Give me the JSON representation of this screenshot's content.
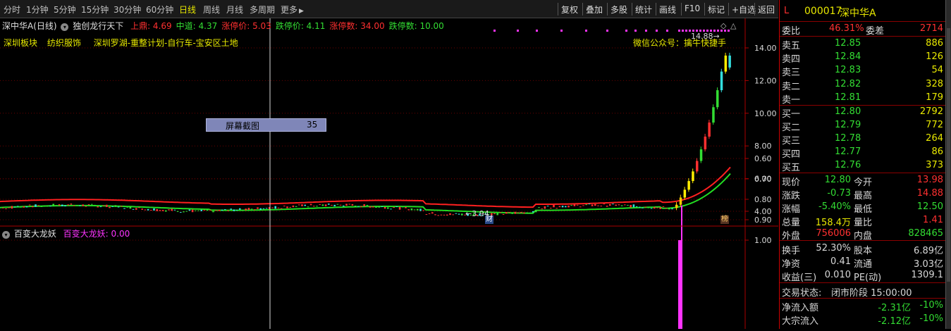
{
  "toolbar": {
    "periods": [
      "分时",
      "1分钟",
      "5分钟",
      "15分钟",
      "30分钟",
      "60分钟",
      "日线",
      "周线",
      "月线",
      "多周期",
      "更多"
    ],
    "active_period": "日线",
    "buttons": [
      "复权",
      "叠加",
      "多股",
      "统计",
      "画线",
      "F10",
      "标记",
      "+自选",
      "返回"
    ]
  },
  "main_chart": {
    "title": "深中华A(日线)",
    "indicator_name": "独创龙行天下",
    "indicators": [
      {
        "label": "上鼎: 4.69",
        "color": "#ff3030"
      },
      {
        "label": "中道: 4.37",
        "color": "#33dd33"
      },
      {
        "label": "涨停价: 5.03",
        "color": "#ff3030"
      },
      {
        "label": "跌停价: 4.11",
        "color": "#33dd33"
      },
      {
        "label": "涨停数: 34.00",
        "color": "#ff3030"
      },
      {
        "label": "跌停数: 10.00",
        "color": "#33dd33"
      }
    ],
    "tags": [
      "深圳板块",
      "纺织服饰",
      "深圳罗湖-重整计划-自行车-宝安区土地"
    ],
    "wechat": "微信公众号：擒牛快捷手",
    "screenshot_label": "屏幕截图",
    "screenshot_value": "35",
    "high_label": "14.88",
    "low_label": "3.94",
    "marker_cai": "财",
    "marker_bang": "榜",
    "price_axis": [
      "14.00",
      "12.00",
      "10.00",
      "8.00",
      "6.00",
      "4.00"
    ]
  },
  "sub_chart": {
    "title": "百变大龙妖",
    "value_label": "百变大龙妖: 0.00",
    "axis": [
      "1.00",
      "0.90",
      "0.80",
      "0.70",
      "0.60"
    ]
  },
  "chart_data": {
    "type": "candlestick",
    "title": "深中华A(日线)",
    "ylim": [
      3.6,
      15.2
    ],
    "base_period_level": 4.2,
    "recent_closes": [
      4.4,
      4.84,
      5.32,
      5.85,
      6.44,
      7.08,
      7.79,
      8.57,
      9.43,
      10.37,
      11.41,
      12.55,
      13.53,
      12.8
    ],
    "upper_band_end": 6.7,
    "lower_band_end": 6.3,
    "sub_indicator_peak": 1.0
  },
  "quote": {
    "code_prefix": "L",
    "code": "000017",
    "name": "深中华A",
    "weibi_label": "委比",
    "weibi_value": "46.31%",
    "weicha_label": "委差",
    "weicha_value": "2714",
    "sells": [
      {
        "label": "卖五",
        "price": "12.85",
        "vol": "886"
      },
      {
        "label": "卖四",
        "price": "12.84",
        "vol": "126"
      },
      {
        "label": "卖三",
        "price": "12.83",
        "vol": "54"
      },
      {
        "label": "卖二",
        "price": "12.82",
        "vol": "328"
      },
      {
        "label": "卖一",
        "price": "12.81",
        "vol": "179"
      }
    ],
    "buys": [
      {
        "label": "买一",
        "price": "12.80",
        "vol": "2792"
      },
      {
        "label": "买二",
        "price": "12.79",
        "vol": "772"
      },
      {
        "label": "买三",
        "price": "12.78",
        "vol": "264"
      },
      {
        "label": "买四",
        "price": "12.77",
        "vol": "86"
      },
      {
        "label": "买五",
        "price": "12.76",
        "vol": "373"
      }
    ],
    "stats1": [
      {
        "l1": "现价",
        "v1": "12.80",
        "c1": "#33dd33",
        "l2": "今开",
        "v2": "13.98",
        "c2": "#ff3030"
      },
      {
        "l1": "涨跌",
        "v1": "-0.73",
        "c1": "#33dd33",
        "l2": "最高",
        "v2": "14.88",
        "c2": "#ff3030"
      },
      {
        "l1": "涨幅",
        "v1": "-5.40%",
        "c1": "#33dd33",
        "l2": "最低",
        "v2": "12.50",
        "c2": "#33dd33"
      },
      {
        "l1": "总量",
        "v1": "158.4万",
        "c1": "#e8e800",
        "l2": "量比",
        "v2": "1.41",
        "c2": "#ff3030"
      },
      {
        "l1": "外盘",
        "v1": "756006",
        "c1": "#ff3030",
        "l2": "内盘",
        "v2": "828465",
        "c2": "#33dd33"
      }
    ],
    "stats2": [
      {
        "l1": "换手",
        "v1": "52.30%",
        "l2": "股本",
        "v2": "6.89亿"
      },
      {
        "l1": "净资",
        "v1": "0.41",
        "l2": "流通",
        "v2": "3.03亿"
      },
      {
        "l1": "收益(三)",
        "v1": "0.010",
        "l2": "PE(动)",
        "v2": "1309.1"
      }
    ],
    "trade_status_label": "交易状态:",
    "trade_status": "闭市阶段 15:00:00",
    "flows": [
      {
        "label": "净流入额",
        "value": "-2.31亿",
        "pct": "-10%"
      },
      {
        "label": "大宗流入",
        "value": "-2.12亿",
        "pct": "-10%"
      }
    ]
  },
  "colors": {
    "up": "#ff3030",
    "down": "#33dd33",
    "yellow": "#e8e800",
    "magenta": "#ff33ff",
    "cyan": "#33dddd",
    "grid": "#8b0000"
  }
}
